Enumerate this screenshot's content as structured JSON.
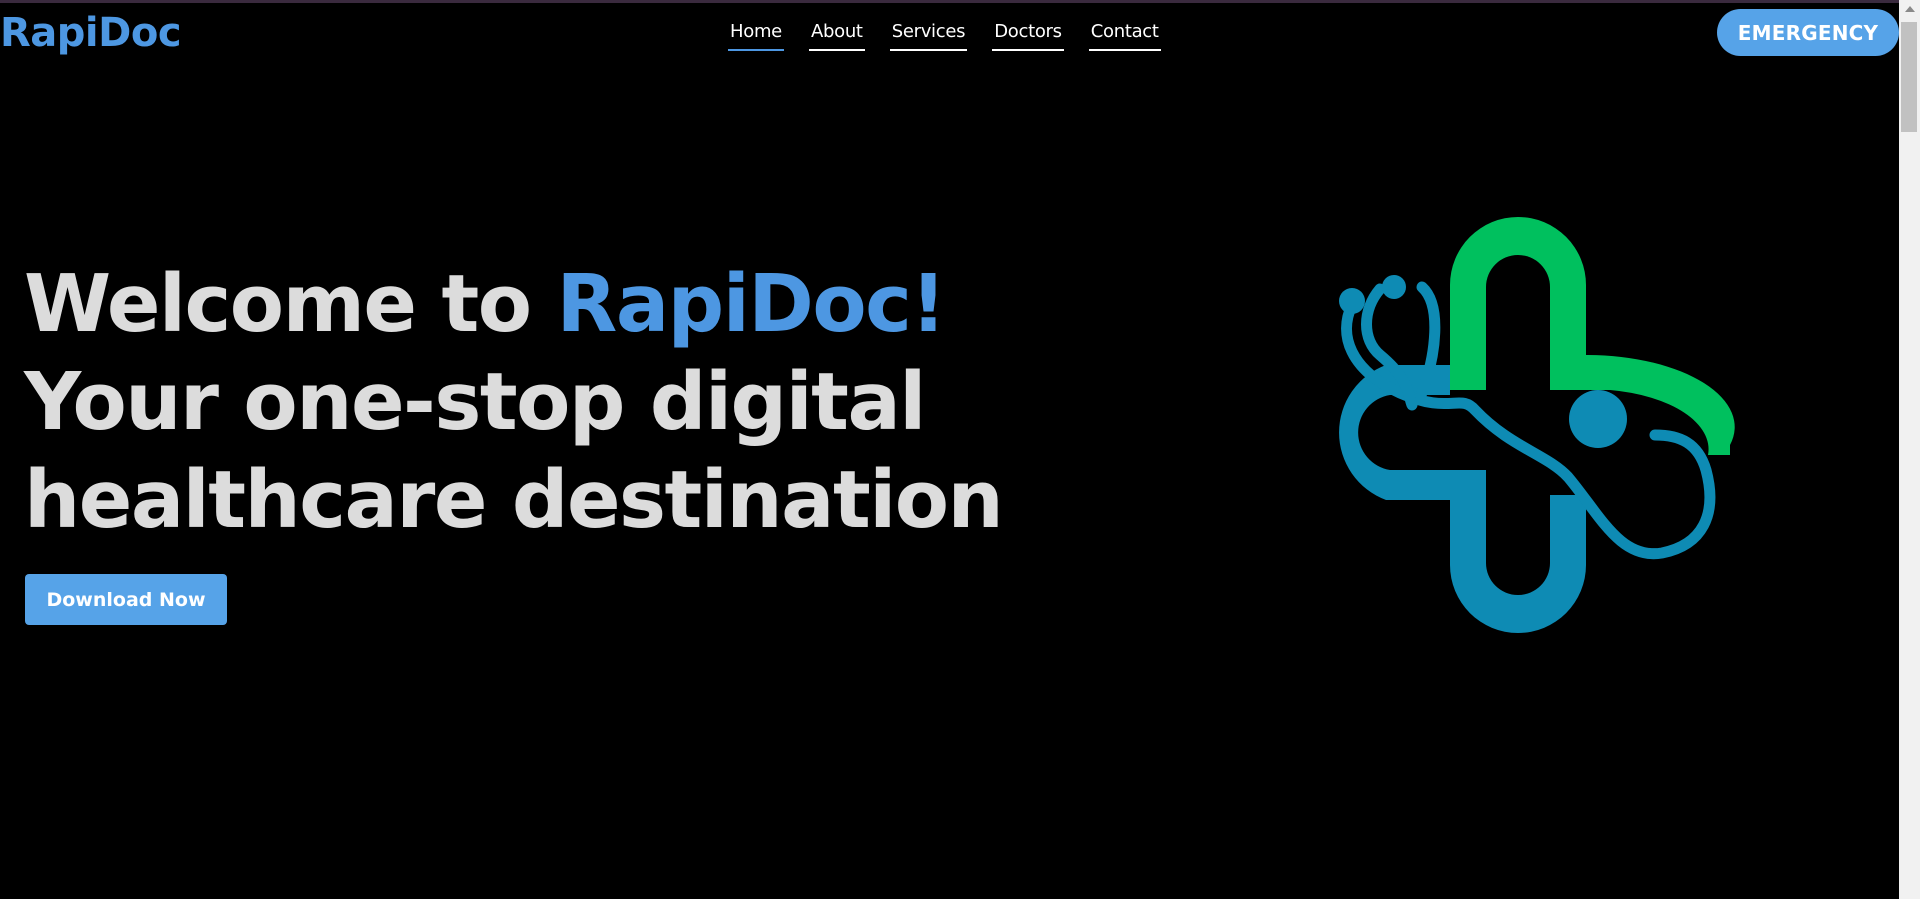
{
  "header": {
    "logo": "RapiDoc",
    "nav": [
      {
        "label": "Home",
        "active": true
      },
      {
        "label": "About",
        "active": false
      },
      {
        "label": "Services",
        "active": false
      },
      {
        "label": "Doctors",
        "active": false
      },
      {
        "label": "Contact",
        "active": false
      }
    ],
    "emergency_label": "EMERGENCY"
  },
  "hero": {
    "line1_prefix": "Welcome to ",
    "line1_brand": "RapiDoc!",
    "line2": "Your one-stop digital",
    "line3": "healthcare destination",
    "cta_label": "Download Now",
    "logo_icon": "medical-cross-stethoscope-icon"
  },
  "colors": {
    "brand_blue": "#4d97e2",
    "button_blue": "#56a3e8",
    "cross_green": "#00c05e",
    "cross_teal": "#0e8bb4",
    "background": "#000000",
    "heading_text": "#dcdcdc"
  }
}
